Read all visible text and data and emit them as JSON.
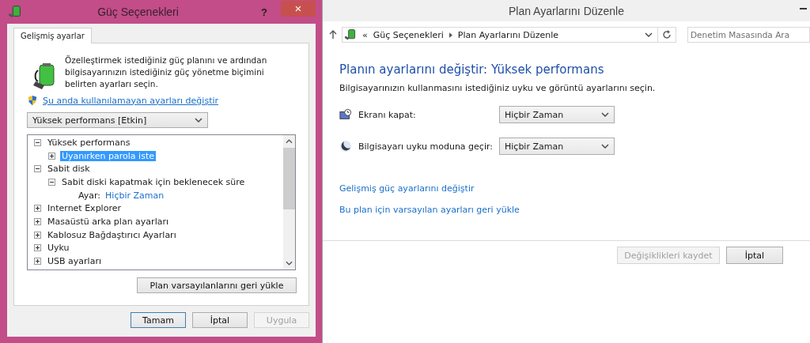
{
  "dialog": {
    "title": "Güç Seçenekleri",
    "help": "?",
    "close": "×",
    "tabs": [
      {
        "label": "Gelişmiş ayarlar",
        "selected": true
      }
    ],
    "intro": "Özelleştirmek istediğiniz güç planını ve ardından bilgisayarınızın istediğiniz güç yönetme biçimini belirten ayarları seçin.",
    "admin_link": "Şu anda kullanılamayan ayarları değiştir",
    "plan_select": "Yüksek performans [Etkin]",
    "tree": [
      {
        "kind": "node",
        "label": "Yüksek performans",
        "expanded": true,
        "selected": false,
        "children": [
          {
            "kind": "node",
            "label": "Uyanırken parola iste",
            "expanded": false,
            "selected": true
          }
        ]
      },
      {
        "kind": "node",
        "label": "Sabit disk",
        "expanded": true,
        "selected": false,
        "children": [
          {
            "kind": "node",
            "label": "Sabit diski kapatmak için beklenecek süre",
            "expanded": true,
            "selected": false,
            "children": [
              {
                "kind": "setting",
                "label": "Ayar:",
                "value": "Hiçbir Zaman",
                "selected": false
              }
            ]
          }
        ]
      },
      {
        "kind": "node",
        "label": "Internet Explorer",
        "expanded": false,
        "selected": false
      },
      {
        "kind": "node",
        "label": "Masaüstü arka plan ayarları",
        "expanded": false,
        "selected": false
      },
      {
        "kind": "node",
        "label": "Kablosuz Bağdaştırıcı Ayarları",
        "expanded": false,
        "selected": false
      },
      {
        "kind": "node",
        "label": "Uyku",
        "expanded": false,
        "selected": false
      },
      {
        "kind": "node",
        "label": "USB ayarları",
        "expanded": false,
        "selected": false
      }
    ],
    "restore_button": "Plan varsayılanlarını geri yükle",
    "buttons": [
      {
        "label": "Tamam",
        "default": true,
        "disabled": false
      },
      {
        "label": "İptal",
        "default": false,
        "disabled": false
      },
      {
        "label": "Uygula",
        "default": false,
        "disabled": true
      }
    ]
  },
  "editor": {
    "title": "Plan Ayarlarını Düzenle",
    "breadcrumb_prefix": "«",
    "breadcrumb": [
      "Güç Seçenekleri",
      "Plan Ayarlarını Düzenle"
    ],
    "search": {
      "placeholder": "Denetim Masasında Ara"
    },
    "heading": "Planın ayarlarını değiştir: Yüksek performans",
    "description": "Bilgisayarınızın kullanmasını istediğiniz uyku ve görüntü ayarlarını seçin.",
    "settings": [
      {
        "kind": "display",
        "label": "Ekranı kapat:",
        "value": "Hiçbir Zaman"
      },
      {
        "kind": "sleep",
        "label": "Bilgisayarı uyku moduna geçir:",
        "value": "Hiçbir Zaman"
      }
    ],
    "links": [
      "Gelişmiş güç ayarlarını değiştir",
      "Bu plan için varsayılan ayarları geri yükle"
    ],
    "buttons": [
      {
        "label": "Değişiklikleri kaydet",
        "disabled": true
      },
      {
        "label": "İptal",
        "disabled": false
      }
    ]
  }
}
